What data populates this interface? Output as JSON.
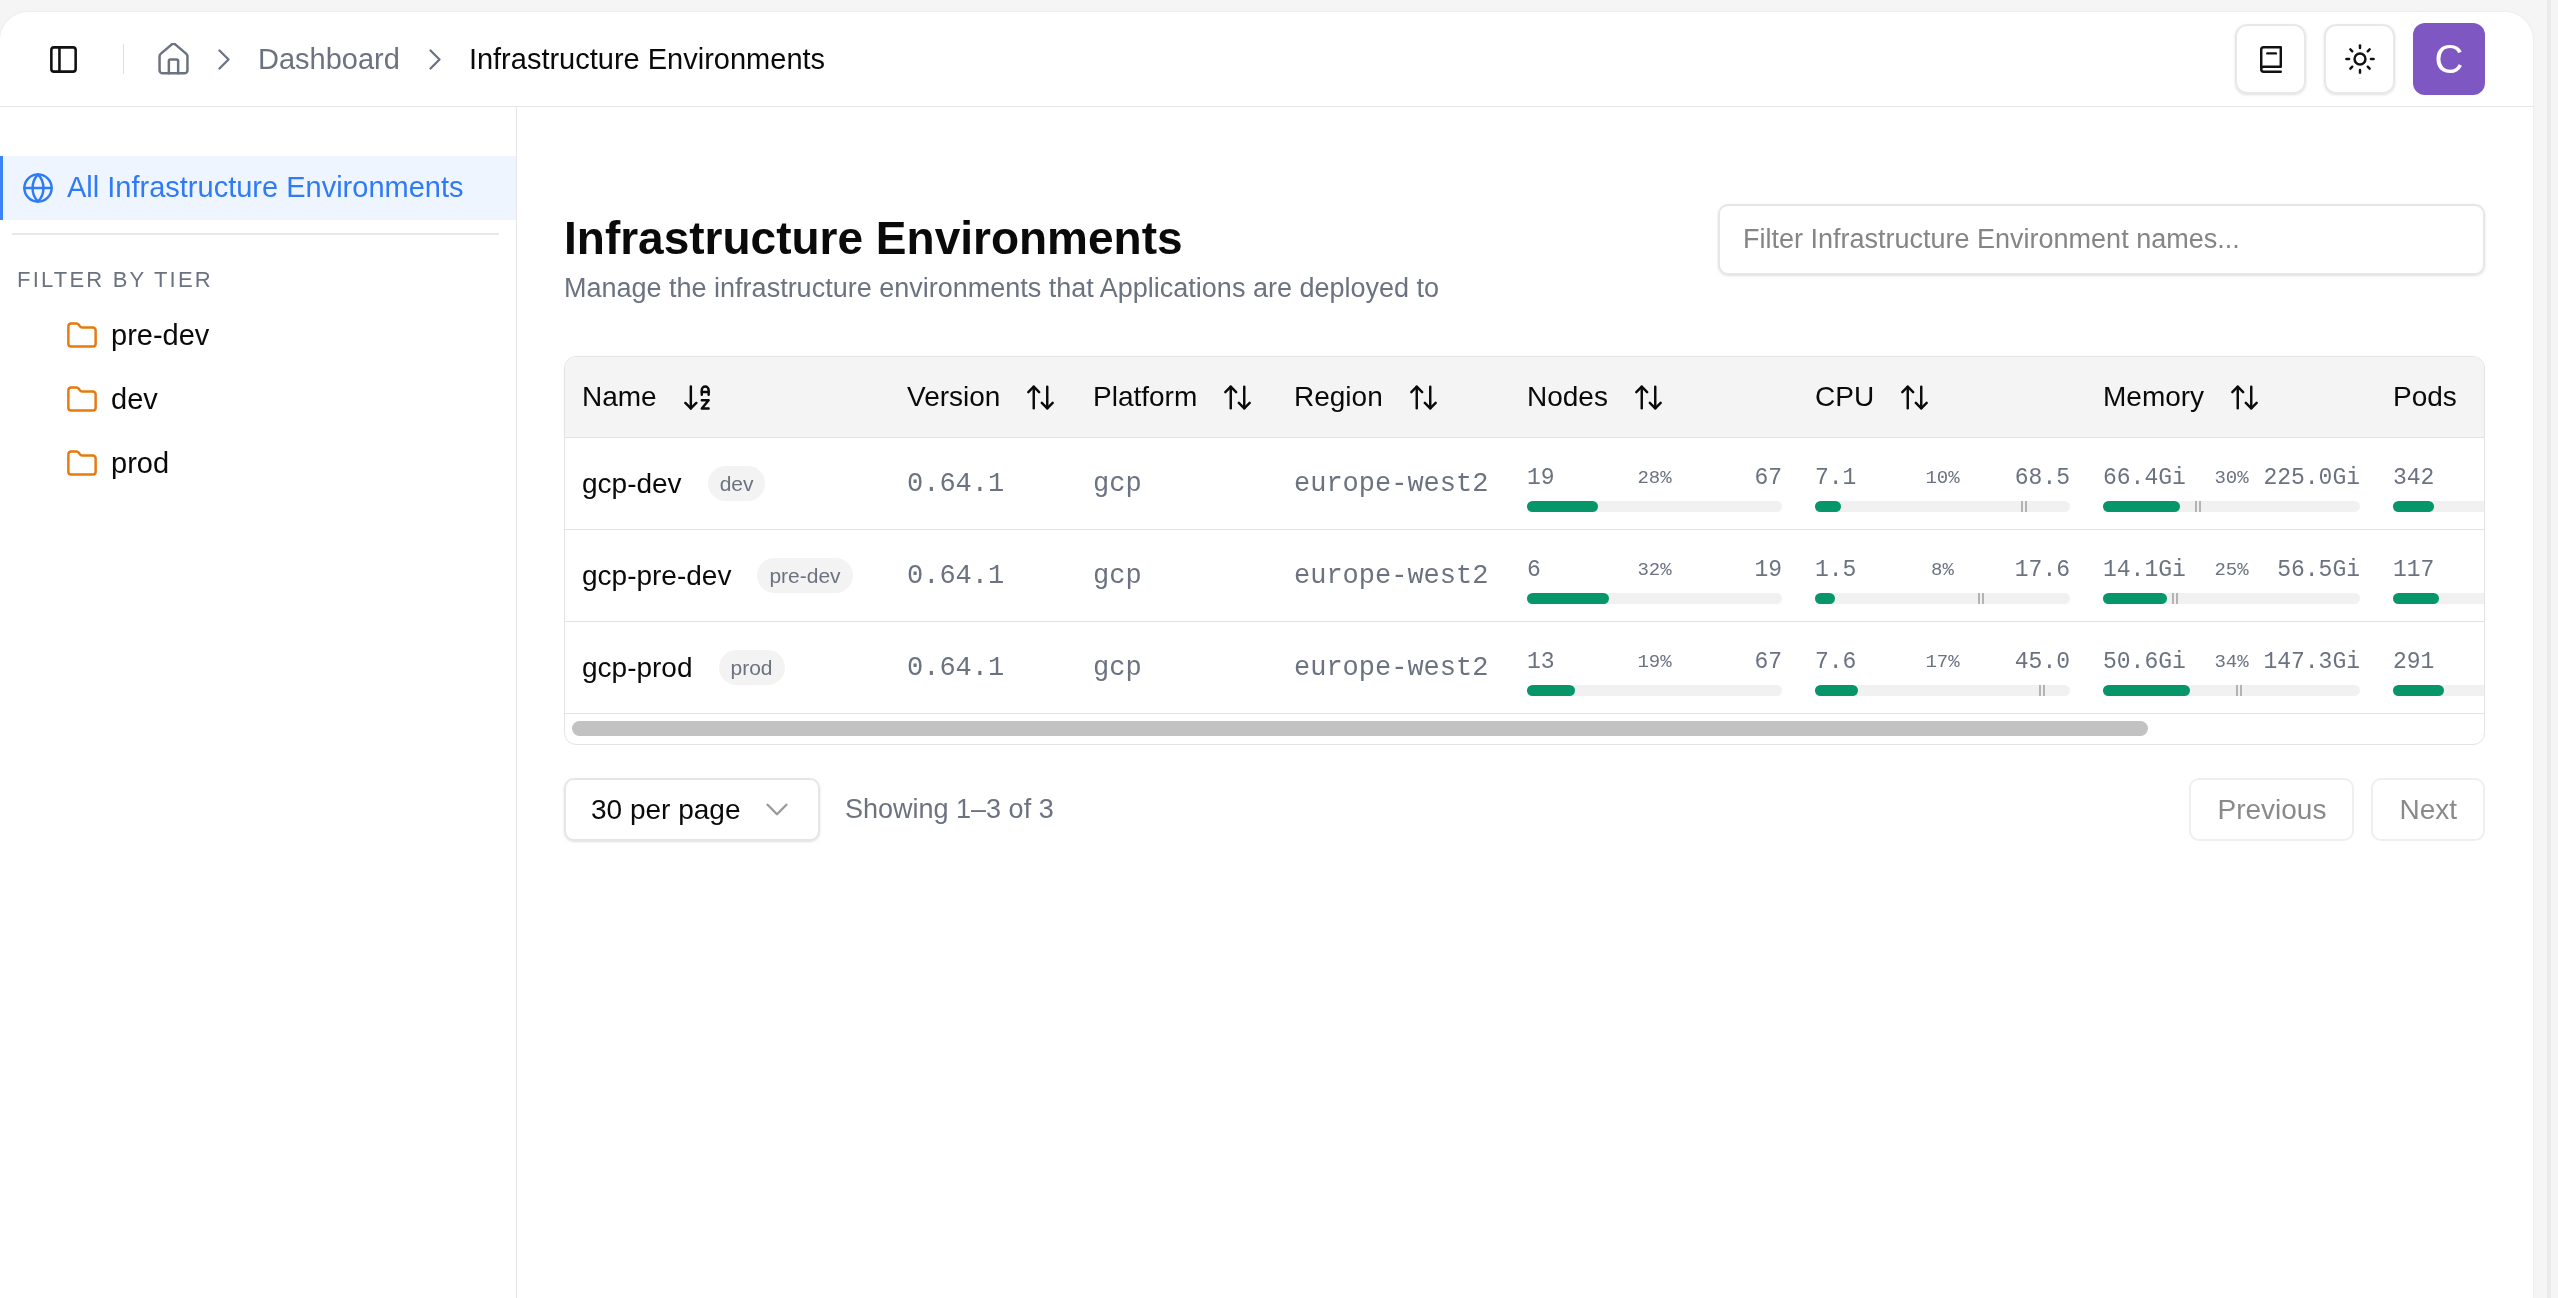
{
  "header": {
    "breadcrumbs": [
      {
        "label": "Dashboard",
        "current": false
      },
      {
        "label": "Infrastructure Environments",
        "current": true
      }
    ],
    "avatar": {
      "initial": "C"
    }
  },
  "sidebar": {
    "all_item": {
      "label": "All Infrastructure Environments",
      "selected": true
    },
    "section_title": "FILTER BY TIER",
    "tiers": [
      {
        "label": "pre-dev",
        "selected": false
      },
      {
        "label": "dev",
        "selected": false
      },
      {
        "label": "prod",
        "selected": false
      }
    ]
  },
  "page": {
    "title": "Infrastructure Environments",
    "subtitle": "Manage the infrastructure environments that Applications are deployed to",
    "filter": {
      "placeholder": "Filter Infrastructure Environment names..."
    }
  },
  "table": {
    "columns": [
      {
        "label": "Name",
        "sortable": true,
        "sorted": true
      },
      {
        "label": "Version",
        "sortable": true,
        "sorted": false
      },
      {
        "label": "Platform",
        "sortable": true,
        "sorted": false
      },
      {
        "label": "Region",
        "sortable": true,
        "sorted": false
      },
      {
        "label": "Nodes",
        "sortable": true,
        "sorted": false
      },
      {
        "label": "CPU",
        "sortable": true,
        "sorted": false
      },
      {
        "label": "Memory",
        "sortable": true,
        "sorted": false
      },
      {
        "label": "Pods",
        "sortable": false
      }
    ],
    "rows": [
      {
        "name": "gcp-dev",
        "tier": "dev",
        "version": "0.64.1",
        "platform": "gcp",
        "region": "europe-west2",
        "nodes": {
          "used": "19",
          "percent": "28%",
          "total": "67",
          "level": 0.28
        },
        "cpu": {
          "used": "7.1",
          "percent": "10%",
          "total": "68.5",
          "level": 0.1,
          "marker": {
            "level": 0.82
          }
        },
        "memory": {
          "used": "66.4Gi",
          "percent": "30%",
          "total": "225.0Gi",
          "level": 0.3,
          "marker": {
            "level": 0.37
          }
        },
        "pods": {
          "count": "342",
          "level": 0.45
        }
      },
      {
        "name": "gcp-pre-dev",
        "tier": "pre-dev",
        "version": "0.64.1",
        "platform": "gcp",
        "region": "europe-west2",
        "nodes": {
          "used": "6",
          "percent": "32%",
          "total": "19",
          "level": 0.32
        },
        "cpu": {
          "used": "1.5",
          "percent": "8%",
          "total": "17.6",
          "level": 0.08,
          "marker": {
            "level": 0.65
          }
        },
        "memory": {
          "used": "14.1Gi",
          "percent": "25%",
          "total": "56.5Gi",
          "level": 0.25,
          "marker": {
            "level": 0.28
          }
        },
        "pods": {
          "count": "117",
          "level": 0.5
        }
      },
      {
        "name": "gcp-prod",
        "tier": "prod",
        "version": "0.64.1",
        "platform": "gcp",
        "region": "europe-west2",
        "nodes": {
          "used": "13",
          "percent": "19%",
          "total": "67",
          "level": 0.19
        },
        "cpu": {
          "used": "7.6",
          "percent": "17%",
          "total": "45.0",
          "level": 0.17,
          "marker": {
            "level": 0.89
          }
        },
        "memory": {
          "used": "50.6Gi",
          "percent": "34%",
          "total": "147.3Gi",
          "level": 0.34,
          "marker": {
            "level": 0.53
          }
        },
        "pods": {
          "count": "291",
          "level": 0.56
        }
      }
    ]
  },
  "pagination": {
    "page_size": "30 per page",
    "summary": "Showing 1–3 of 3",
    "buttons": [
      {
        "label": "Previous",
        "disabled": true
      },
      {
        "label": "Next",
        "disabled": true
      }
    ]
  }
}
